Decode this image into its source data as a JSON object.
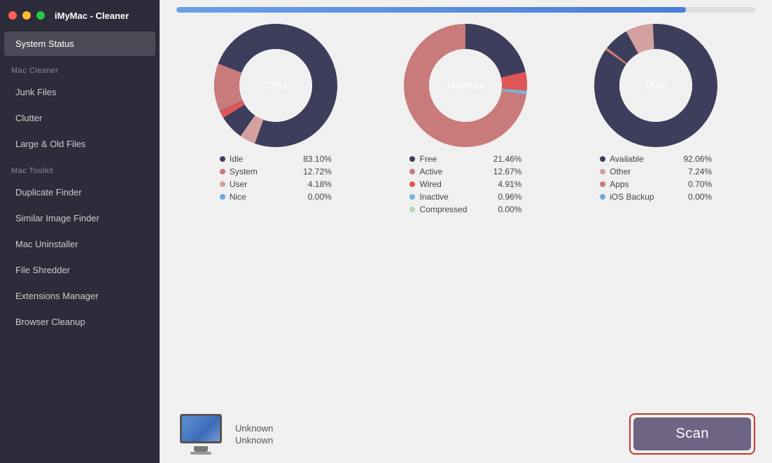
{
  "app": {
    "title": "iMyMac - Cleaner"
  },
  "sidebar": {
    "section_mac_cleaner": "Mac Cleaner",
    "section_mac_toolkit": "Mac Toolkit",
    "items": [
      {
        "id": "system-status",
        "label": "System Status",
        "active": true
      },
      {
        "id": "junk-files",
        "label": "Junk Files",
        "active": false
      },
      {
        "id": "clutter",
        "label": "Clutter",
        "active": false
      },
      {
        "id": "large-old-files",
        "label": "Large & Old Files",
        "active": false
      },
      {
        "id": "duplicate-finder",
        "label": "Duplicate Finder",
        "active": false
      },
      {
        "id": "similar-image-finder",
        "label": "Similar Image Finder",
        "active": false
      },
      {
        "id": "mac-uninstaller",
        "label": "Mac Uninstaller",
        "active": false
      },
      {
        "id": "file-shredder",
        "label": "File Shredder",
        "active": false
      },
      {
        "id": "extensions-manager",
        "label": "Extensions Manager",
        "active": false
      },
      {
        "id": "browser-cleanup",
        "label": "Browser Cleanup",
        "active": false
      }
    ]
  },
  "progress": {
    "value": 88
  },
  "charts": {
    "cpu": {
      "label": "CPU",
      "segments": [
        {
          "name": "Idle",
          "value": 83.1,
          "color": "#3d3d5c",
          "percent": 83.1
        },
        {
          "name": "System",
          "value": 12.72,
          "color": "#c97a7a",
          "percent": 12.72
        },
        {
          "name": "User",
          "value": 4.18,
          "color": "#d4a0a0",
          "percent": 4.18
        },
        {
          "name": "Nice",
          "value": 0.0,
          "color": "#6fa8dc",
          "percent": 0.0
        }
      ]
    },
    "memory": {
      "label": "Memory",
      "segments": [
        {
          "name": "Free",
          "value": 21.46,
          "color": "#3d3d5c",
          "percent": 21.46
        },
        {
          "name": "Active",
          "value": 12.67,
          "color": "#c97a7a",
          "percent": 12.67
        },
        {
          "name": "Wired",
          "value": 4.91,
          "color": "#e87070",
          "percent": 4.91
        },
        {
          "name": "Inactive",
          "value": 0.96,
          "color": "#7ab0dc",
          "percent": 0.96
        },
        {
          "name": "Compressed",
          "value": 0.0,
          "color": "#b8d4a8",
          "percent": 0.0
        }
      ]
    },
    "disk": {
      "label": "Disk",
      "segments": [
        {
          "name": "Available",
          "value": 92.06,
          "color": "#3d3d5c",
          "percent": 92.06
        },
        {
          "name": "Other",
          "value": 7.24,
          "color": "#d4a0a0",
          "percent": 7.24
        },
        {
          "name": "Apps",
          "value": 0.7,
          "color": "#c97a7a",
          "percent": 0.7
        },
        {
          "name": "iOS Backup",
          "value": 0.0,
          "color": "#6fa8dc",
          "percent": 0.0
        }
      ]
    }
  },
  "legend_colors": {
    "dark_purple": "#3d3d5c",
    "pink_light": "#d4a0a0",
    "pink_medium": "#c97a7a",
    "red": "#e87070",
    "blue": "#7ab0dc",
    "green": "#b8d4a8"
  },
  "bottom": {
    "mac_model_line1": "Unknown",
    "mac_model_line2": "Unknown",
    "scan_label": "Scan"
  }
}
